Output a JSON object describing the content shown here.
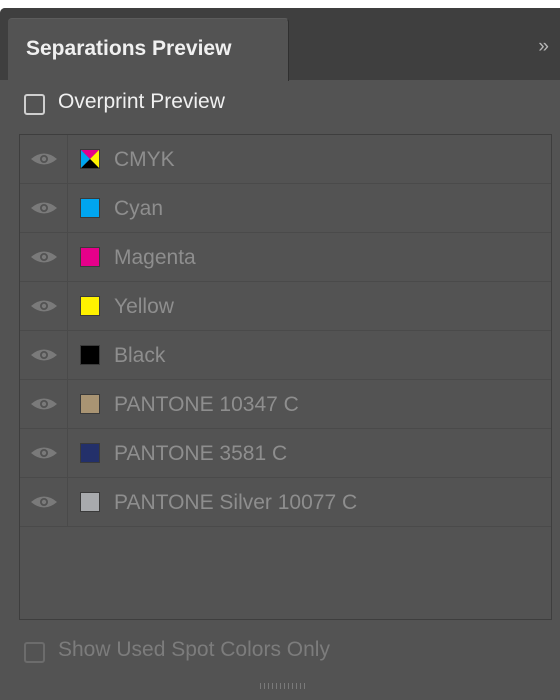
{
  "panel": {
    "tab_title": "Separations Preview",
    "collapse_icon": "double-chevron-right-icon",
    "collapse_glyph": "»"
  },
  "overprint_preview": {
    "label": "Overprint Preview",
    "checked": false
  },
  "separations": [
    {
      "label": "CMYK",
      "swatch": "cmyk",
      "visible": true
    },
    {
      "label": "Cyan",
      "swatch": "#00a5ef",
      "visible": true
    },
    {
      "label": "Magenta",
      "swatch": "#e6008a",
      "visible": true
    },
    {
      "label": "Yellow",
      "swatch": "#fff200",
      "visible": true
    },
    {
      "label": "Black",
      "swatch": "#000000",
      "visible": true
    },
    {
      "label": "PANTONE 10347 C",
      "swatch": "#a99473",
      "visible": true
    },
    {
      "label": "PANTONE 3581 C",
      "swatch": "#23306a",
      "visible": true
    },
    {
      "label": "PANTONE Silver 10077 C",
      "swatch": "#a8aaad",
      "visible": true
    }
  ],
  "show_used_spot_colors": {
    "label": "Show Used Spot Colors Only",
    "checked": false,
    "enabled": false
  }
}
